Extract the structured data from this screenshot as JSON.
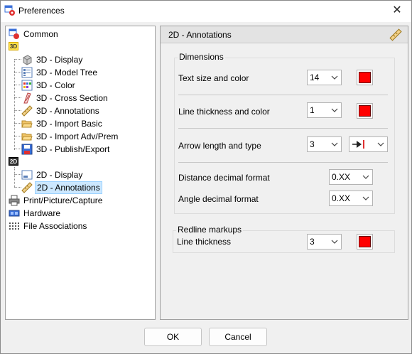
{
  "window": {
    "title": "Preferences",
    "close_glyph": "✕"
  },
  "tree": {
    "common": "Common",
    "group3d_badge": "3D",
    "items3d": [
      {
        "label": "3D - Display",
        "icon": "cube-icon"
      },
      {
        "label": "3D - Model Tree",
        "icon": "model-tree-icon"
      },
      {
        "label": "3D - Color",
        "icon": "color-grid-icon"
      },
      {
        "label": "3D - Cross Section",
        "icon": "cross-section-icon"
      },
      {
        "label": "3D - Annotations",
        "icon": "ruler-icon"
      },
      {
        "label": "3D - Import Basic",
        "icon": "folder-open-icon"
      },
      {
        "label": "3D - Import Adv/Prem",
        "icon": "folder-open-icon"
      },
      {
        "label": "3D - Publish/Export",
        "icon": "floppy-disk-icon"
      }
    ],
    "group2d_badge": "2D",
    "items2d": [
      {
        "label": "2D - Display",
        "icon": "display-icon"
      },
      {
        "label": "2D - Annotations",
        "icon": "ruler-icon",
        "selected": true
      }
    ],
    "print": "Print/Picture/Capture",
    "hardware": "Hardware",
    "file_assoc": "File Associations"
  },
  "panel": {
    "title": "2D - Annotations",
    "dimensions": {
      "title": "Dimensions",
      "text_size_label": "Text size and color",
      "text_size_value": "14",
      "line_thickness_label": "Line thickness and color",
      "line_thickness_value": "1",
      "arrow_label": "Arrow length and type",
      "arrow_length_value": "3",
      "distance_label": "Distance decimal format",
      "distance_value": "0.XX",
      "angle_label": "Angle decimal format",
      "angle_value": "0.XX"
    },
    "redline": {
      "title": "Redline markups",
      "thickness_label": "Line thickness",
      "thickness_value": "3"
    },
    "swatch_color": "#ff0000"
  },
  "buttons": {
    "ok": "OK",
    "cancel": "Cancel"
  }
}
